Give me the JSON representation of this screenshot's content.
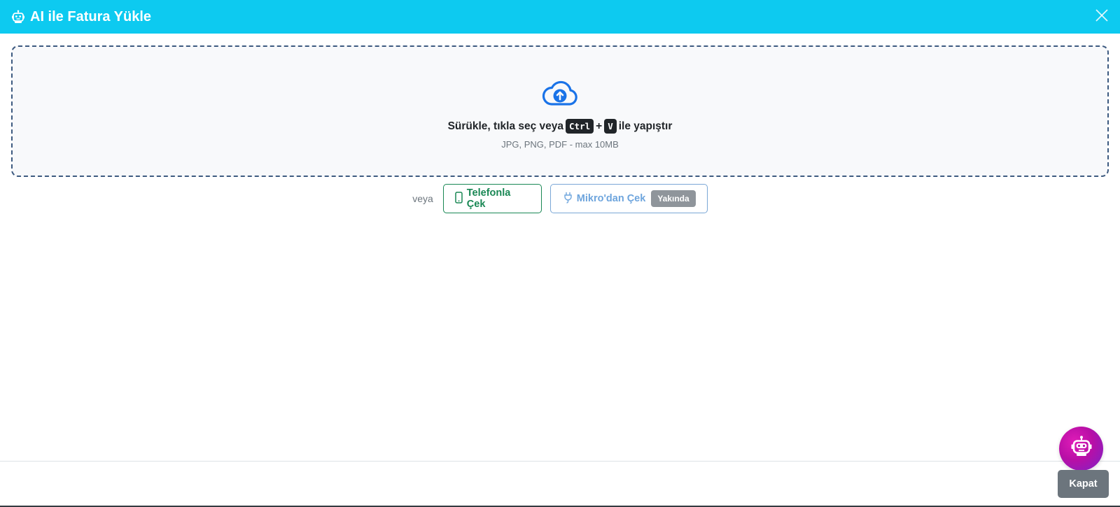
{
  "modal": {
    "title": "AI ile Fatura Yükle",
    "title_icon": "robot-icon",
    "close_icon": "close-icon"
  },
  "dropzone": {
    "icon": "cloud-upload-icon",
    "text_before": "Sürükle, tıkla seç veya",
    "key_ctrl": "Ctrl",
    "plus": "+",
    "key_v": "V",
    "text_after": "ile yapıştır",
    "hint": "JPG, PNG, PDF - max 10MB"
  },
  "alternatives": {
    "or_label": "veya",
    "phone_button": {
      "icon": "phone-icon",
      "label": "Telefonla Çek"
    },
    "mikro_button": {
      "icon": "plug-icon",
      "label": "Mikro'dan Çek",
      "badge": "Yakında"
    }
  },
  "footer": {
    "close_label": "Kapat",
    "assistant_icon": "robot-icon"
  },
  "colors": {
    "header": "#0dcaf0",
    "success": "#198754",
    "secondary": "#6c757d",
    "upload_icon": "#1a73e8"
  }
}
